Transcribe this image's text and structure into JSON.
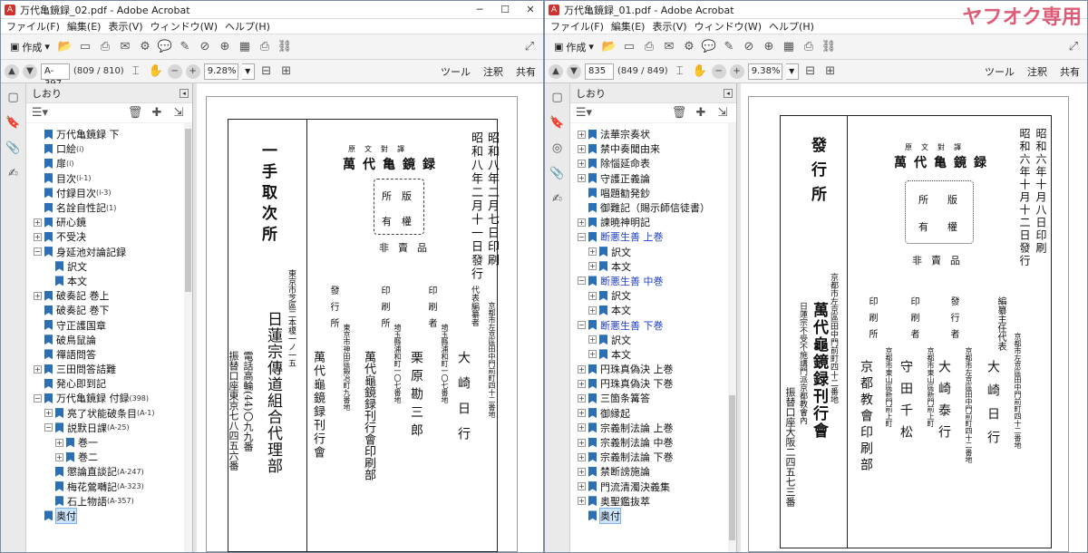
{
  "left": {
    "title": "万代亀鏡録_02.pdf - Adobe Acrobat",
    "menu": [
      "ファイル(F)",
      "編集(E)",
      "表示(V)",
      "ウィンドウ(W)",
      "ヘルプ(H)"
    ],
    "create_label": "作成",
    "page_value": "A-397",
    "page_count": "(809 / 810)",
    "zoom": "9.28%",
    "links": [
      "ツール",
      "注釈",
      "共有"
    ],
    "panel_title": "しおり",
    "bookmarks": [
      {
        "label": "万代亀鏡録 下",
        "sub": ""
      },
      {
        "label": "口絵",
        "sub": "(i)"
      },
      {
        "label": "扉",
        "sub": "(i)"
      },
      {
        "label": "目次",
        "sub": "(i-1)"
      },
      {
        "label": "付録目次",
        "sub": "(i-3)"
      },
      {
        "label": "名詮自性記",
        "sub": "(1)"
      },
      {
        "label": "研心鏡",
        "sub": ""
      },
      {
        "label": "不受决",
        "sub": ""
      },
      {
        "label": "身延池対論記録",
        "sub": ""
      },
      {
        "label": "訳文",
        "sub": ""
      },
      {
        "label": "本文",
        "sub": ""
      },
      {
        "label": "破奏記 巻上",
        "sub": ""
      },
      {
        "label": "破奏記 巻下",
        "sub": ""
      },
      {
        "label": "守正護国章",
        "sub": ""
      },
      {
        "label": "破鳥鼠論",
        "sub": ""
      },
      {
        "label": "禪語問答",
        "sub": ""
      },
      {
        "label": "三田問答詰難",
        "sub": ""
      },
      {
        "label": "発心即到記",
        "sub": ""
      },
      {
        "label": "万代亀鏡録 付録",
        "sub": "(398)"
      },
      {
        "label": "亮了状能破条目",
        "sub": "(A-1)"
      },
      {
        "label": "説默日課",
        "sub": "(A-25)"
      },
      {
        "label": "巻一",
        "sub": ""
      },
      {
        "label": "巻二",
        "sub": ""
      },
      {
        "label": "懲論直談記",
        "sub": "(A-247)"
      },
      {
        "label": "梅花鶯囀記",
        "sub": "(A-323)"
      },
      {
        "label": "石上物語",
        "sub": "(A-357)"
      },
      {
        "label": "奥付",
        "sub": ""
      }
    ],
    "doc": {
      "heading": "一手取次所",
      "dates": [
        "昭和八年二月七日印刷",
        "昭和八年二月十一日發行"
      ],
      "label_top": "萬代亀鏡録",
      "label_small": "原文對譯",
      "seal": [
        "版",
        "權",
        "所",
        "有"
      ],
      "price": "非賣品",
      "roles": [
        "代表編纂者",
        "印刷者",
        "印刷所",
        "發行所"
      ],
      "addrs": [
        "京都市左京區田中門前町四十二番地",
        "埼玉縣浦和町一〇七番地",
        "埼玉縣浦和町一〇七番地",
        "東京市神田區鍛冶町九番地"
      ],
      "names": [
        "大崎日行",
        "栗原勘三郎",
        "萬代龜鏡録刊行會印刷部",
        "萬代龜鏡録刊行會"
      ],
      "agent": "日蓮宗傳道組合代理部",
      "agent_addr": "東京市芝區二本榎一ノ一五",
      "tel": "電話高輪(44)〇九九番",
      "furikae": "振替口座東京七八四五六番"
    }
  },
  "right": {
    "title": "万代亀鏡録_01.pdf - Adobe Acrobat",
    "menu": [
      "ファイル(F)",
      "編集(E)",
      "表示(V)",
      "ウィンドウ(W)",
      "ヘルプ(H)"
    ],
    "create_label": "作成",
    "page_value": "835",
    "page_count": "(849 / 849)",
    "zoom": "9.38%",
    "links": [
      "ツール",
      "注釈",
      "共有"
    ],
    "panel_title": "しおり",
    "watermark": "ヤフオク専用",
    "bookmarks": [
      {
        "label": "法華宗奏状",
        "sub": ""
      },
      {
        "label": "禁中奏聞由来",
        "sub": ""
      },
      {
        "label": "除惱延命表",
        "sub": ""
      },
      {
        "label": "守護正義論",
        "sub": ""
      },
      {
        "label": "唱題勧発鈔",
        "sub": ""
      },
      {
        "label": "御難記（賜示師信徒書）",
        "sub": ""
      },
      {
        "label": "諫暁神明記",
        "sub": ""
      },
      {
        "label": "断悪生善 上巻",
        "sub": ""
      },
      {
        "label": "訳文",
        "sub": ""
      },
      {
        "label": "本文",
        "sub": ""
      },
      {
        "label": "断悪生善 中巻",
        "sub": ""
      },
      {
        "label": "訳文",
        "sub": ""
      },
      {
        "label": "本文",
        "sub": ""
      },
      {
        "label": "断悪生善 下巻",
        "sub": ""
      },
      {
        "label": "訳文",
        "sub": ""
      },
      {
        "label": "本文",
        "sub": ""
      },
      {
        "label": "円珠真偽決 上巻",
        "sub": ""
      },
      {
        "label": "円珠真偽決 下巻",
        "sub": ""
      },
      {
        "label": "三箇条篝答",
        "sub": ""
      },
      {
        "label": "御縁起",
        "sub": ""
      },
      {
        "label": "宗義制法論 上巻",
        "sub": ""
      },
      {
        "label": "宗義制法論 中巻",
        "sub": ""
      },
      {
        "label": "宗義制法論 下巻",
        "sub": ""
      },
      {
        "label": "禁断謗施論",
        "sub": ""
      },
      {
        "label": "門流清濁決義集",
        "sub": ""
      },
      {
        "label": "奥聖鑑抜萃",
        "sub": ""
      },
      {
        "label": "奥付",
        "sub": ""
      }
    ],
    "doc": {
      "heading": "發行所",
      "dates": [
        "昭和六年十月八日印刷",
        "昭和六年十月十二日發行"
      ],
      "label_top": "萬代亀鏡録",
      "label_small": "原文對譯",
      "seal": [
        "版",
        "權",
        "所",
        "有"
      ],
      "price": "非賣品",
      "roles": [
        "編纂主任代表",
        "發行者",
        "印刷者",
        "印刷所"
      ],
      "addrs": [
        "京都市左京區田中門前町四十二番地",
        "京都市左京區田中門前町四十二番地",
        "京都市東山區新門前上町",
        "京都市東山區新門前上町"
      ],
      "names": [
        "大崎日行",
        "大崎泰行",
        "守田千松",
        "京都教會印刷部"
      ],
      "agent": "萬代龜鏡録刊行會",
      "agent_addr": "京都市左京區田中門前町四十二番地",
      "tel": "日蓮宗不受不施講門派京都教會內",
      "furikae": "振替口座大阪二四五七三番"
    }
  }
}
